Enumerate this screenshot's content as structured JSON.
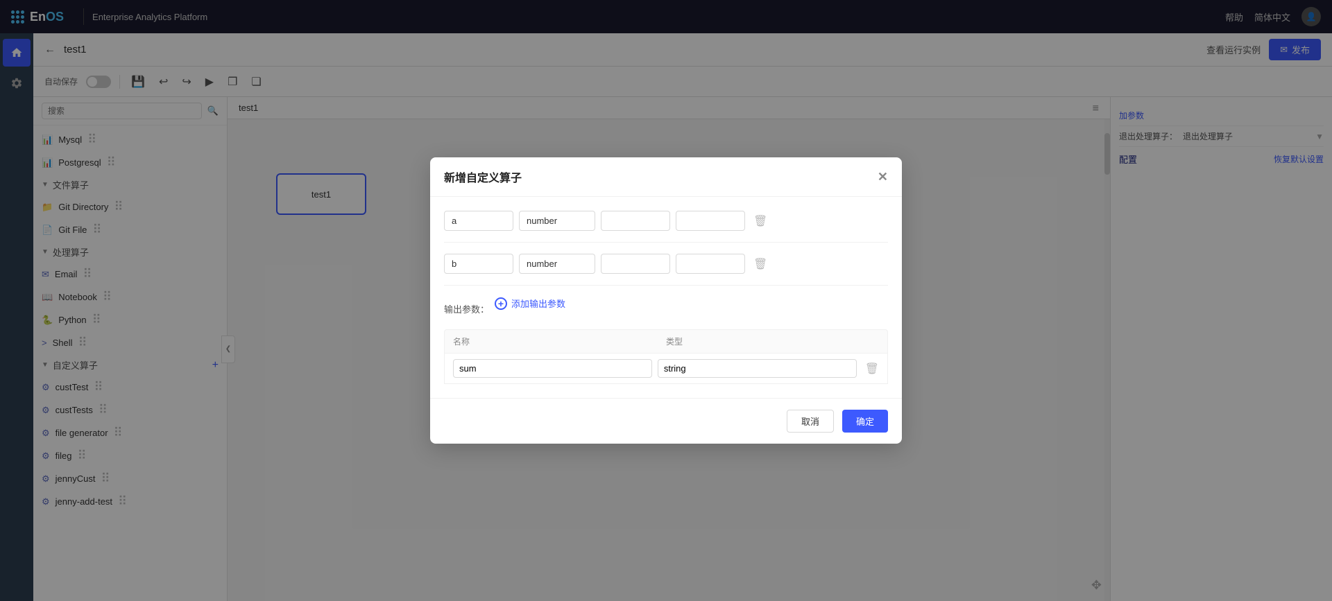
{
  "topNav": {
    "appName": "En",
    "appNameSuffix": "OS",
    "platformTitle": "Enterprise Analytics Platform",
    "helpLabel": "帮助",
    "langLabel": "简体中文"
  },
  "subHeader": {
    "backLabel": "←",
    "pageTitle": "test1",
    "viewInstanceLabel": "查看运行实例",
    "publishLabel": "发布"
  },
  "toolbar": {
    "autoSaveLabel": "自动保存"
  },
  "search": {
    "placeholder": "搜索"
  },
  "leftPanel": {
    "items": [
      {
        "label": "Mysql",
        "type": "db"
      },
      {
        "label": "Postgresql",
        "type": "db"
      }
    ],
    "sections": [
      {
        "label": "文件算子",
        "items": [
          {
            "label": "Git Directory"
          },
          {
            "label": "Git File"
          }
        ]
      },
      {
        "label": "处理算子",
        "items": [
          {
            "label": "Email"
          },
          {
            "label": "Notebook"
          },
          {
            "label": "Python"
          },
          {
            "label": "Shell"
          }
        ]
      },
      {
        "label": "自定义算子",
        "items": [
          {
            "label": "custTest"
          },
          {
            "label": "custTests"
          },
          {
            "label": "file generator"
          },
          {
            "label": "fileg"
          },
          {
            "label": "jennyCust"
          },
          {
            "label": "jenny-add-test"
          }
        ]
      }
    ]
  },
  "canvasTab": {
    "label": "test1"
  },
  "modal": {
    "title": "新增自定义算子",
    "inputParams": {
      "rows": [
        {
          "name": "a",
          "type": "number",
          "val1": "",
          "val2": ""
        },
        {
          "name": "b",
          "type": "number",
          "val1": "",
          "val2": ""
        }
      ]
    },
    "outputParams": {
      "sectionLabel": "输出参数：",
      "addLabel": "添加输出参数",
      "tableHeaders": {
        "name": "名称",
        "type": "类型"
      },
      "rows": [
        {
          "name": "sum",
          "type": "string"
        }
      ]
    },
    "cancelLabel": "取消",
    "confirmLabel": "确定"
  },
  "rightPanel": {
    "addParamsLabel": "加参数",
    "outputProcessLabel": "退出处理算子：",
    "outputProcessVal": "退出处理算子",
    "configSection": "配置",
    "restoreDefaultLabel": "恢复默认设置"
  }
}
